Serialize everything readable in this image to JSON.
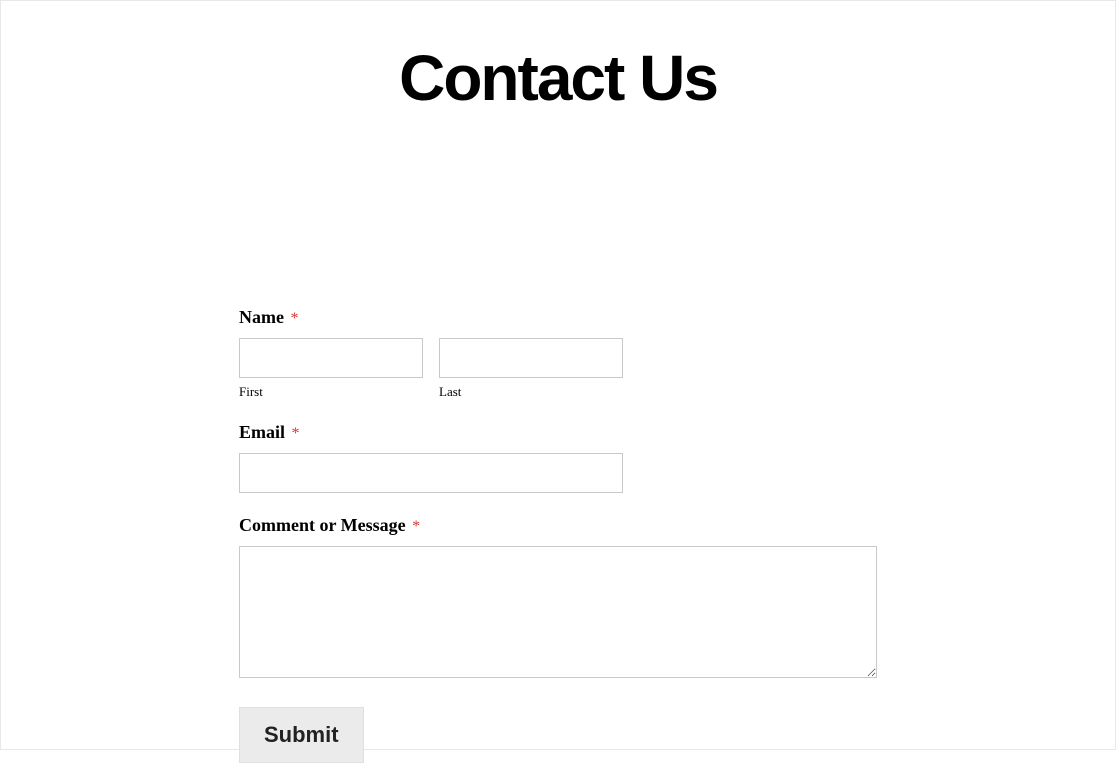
{
  "header": {
    "title": "Contact Us"
  },
  "form": {
    "name": {
      "label": "Name",
      "required_marker": "*",
      "first": {
        "sublabel": "First",
        "value": ""
      },
      "last": {
        "sublabel": "Last",
        "value": ""
      }
    },
    "email": {
      "label": "Email",
      "required_marker": "*",
      "value": ""
    },
    "message": {
      "label": "Comment or Message",
      "required_marker": "*",
      "value": ""
    },
    "submit": {
      "label": "Submit"
    }
  }
}
